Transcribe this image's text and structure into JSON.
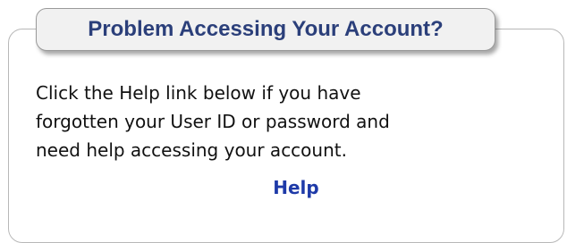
{
  "panel": {
    "title": "Problem Accessing Your Account?",
    "body_lines": [
      "Click the Help link below if you have",
      "forgotten your User ID or password and",
      "need help accessing your account."
    ],
    "help_link": "Help"
  },
  "colors": {
    "title": "#2b3f7a",
    "link": "#1e3aa8",
    "border": "#b8b8b8",
    "tab_background": "#f1f1f1"
  }
}
